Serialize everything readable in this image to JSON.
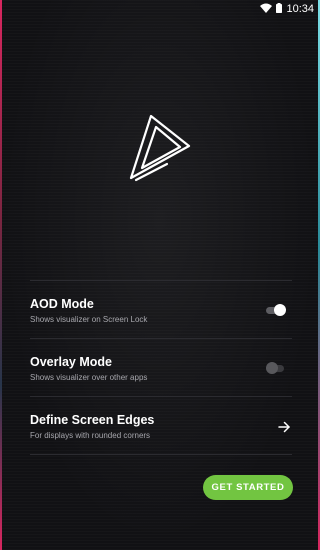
{
  "status_bar": {
    "time": "10:34",
    "icons": [
      "wifi-icon",
      "battery-icon"
    ]
  },
  "logo": {
    "icon": "triangle-play-logo-icon"
  },
  "settings": [
    {
      "title": "AOD Mode",
      "subtitle": "Shows visualizer on Screen Lock",
      "control": "toggle",
      "enabled": true
    },
    {
      "title": "Overlay Mode",
      "subtitle": "Shows visualizer over other apps",
      "control": "toggle",
      "enabled": false
    },
    {
      "title": "Define Screen Edges",
      "subtitle": "For displays with rounded corners",
      "control": "arrow-right-icon"
    }
  ],
  "cta": {
    "label": "GET STARTED"
  },
  "colors": {
    "background": "#111114",
    "accent": "#72c541",
    "edge_left": "#d9265f",
    "edge_right": "#7de0e8"
  }
}
